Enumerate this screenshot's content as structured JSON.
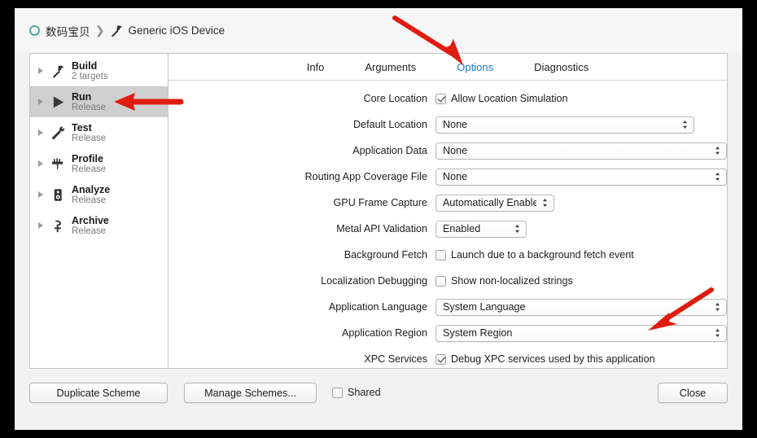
{
  "breadcrumb": {
    "project_icon": "circle-outline-icon",
    "project": "数码宝贝",
    "separator": "❯",
    "device_icon": "hammer-icon",
    "device": "Generic iOS Device"
  },
  "sidebar": {
    "items": [
      {
        "name": "Build",
        "detail": "2 targets",
        "icon": "hammer-icon",
        "selected": false
      },
      {
        "name": "Run",
        "detail": "Release",
        "icon": "play-icon",
        "selected": true
      },
      {
        "name": "Test",
        "detail": "Release",
        "icon": "wrench-icon",
        "selected": false
      },
      {
        "name": "Profile",
        "detail": "Release",
        "icon": "gauge-icon",
        "selected": false
      },
      {
        "name": "Analyze",
        "detail": "Release",
        "icon": "analyze-icon",
        "selected": false
      },
      {
        "name": "Archive",
        "detail": "Release",
        "icon": "archive-icon",
        "selected": false
      }
    ]
  },
  "tabs": [
    {
      "label": "Info",
      "active": false
    },
    {
      "label": "Arguments",
      "active": false
    },
    {
      "label": "Options",
      "active": true
    },
    {
      "label": "Diagnostics",
      "active": false
    }
  ],
  "options": {
    "core_location": {
      "label": "Core Location",
      "checkbox_label": "Allow Location Simulation",
      "checked": true
    },
    "default_location": {
      "label": "Default Location",
      "value": "None"
    },
    "application_data": {
      "label": "Application Data",
      "value": "None"
    },
    "routing_app_coverage": {
      "label": "Routing App Coverage File",
      "value": "None"
    },
    "gpu_frame_capture": {
      "label": "GPU Frame Capture",
      "value": "Automatically Enabled"
    },
    "metal_api_validation": {
      "label": "Metal API Validation",
      "value": "Enabled"
    },
    "background_fetch": {
      "label": "Background Fetch",
      "checkbox_label": "Launch due to a background fetch event",
      "checked": false
    },
    "localization_debugging": {
      "label": "Localization Debugging",
      "checkbox_label": "Show non-localized strings",
      "checked": false
    },
    "application_language": {
      "label": "Application Language",
      "value": "System Language"
    },
    "application_region": {
      "label": "Application Region",
      "value": "System Region"
    },
    "xpc_services": {
      "label": "XPC Services",
      "checkbox_label": "Debug XPC services used by this application",
      "checked": true
    }
  },
  "footer": {
    "duplicate_scheme": "Duplicate Scheme",
    "manage_schemes": "Manage Schemes...",
    "shared_label": "Shared",
    "shared_checked": false,
    "close": "Close"
  },
  "annotations": {
    "color": "#e01b10",
    "arrows": [
      {
        "name": "arrow-to-options-tab",
        "target": "Options tab"
      },
      {
        "name": "arrow-to-run-scheme",
        "target": "Run sidebar row"
      },
      {
        "name": "arrow-to-application-region",
        "target": "Application Region popup"
      }
    ]
  }
}
